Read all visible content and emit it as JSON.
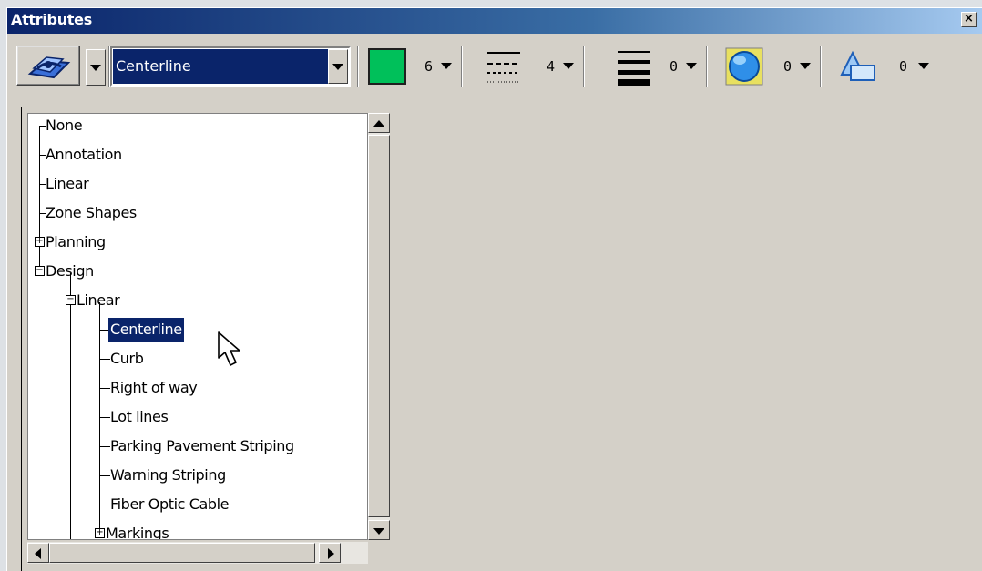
{
  "window": {
    "title": "Attributes",
    "close_label": "×"
  },
  "toolbar": {
    "level_combo_value": "Centerline",
    "color_value": "6",
    "style_value": "4",
    "weight_value": "0",
    "transparency_value": "0",
    "priority_value": "0",
    "colors": {
      "element_color": "#00c05a",
      "selection": "#0a246a"
    }
  },
  "tree": {
    "nodes": [
      {
        "label": "None"
      },
      {
        "label": "Annotation"
      },
      {
        "label": "Linear"
      },
      {
        "label": "Zone Shapes"
      },
      {
        "label": "Planning",
        "expander": "+"
      },
      {
        "label": "Design",
        "expander": "−"
      },
      {
        "label": "Linear",
        "expander": "−"
      },
      {
        "label": "Centerline",
        "selected": true
      },
      {
        "label": "Curb"
      },
      {
        "label": "Right of way"
      },
      {
        "label": "Lot lines"
      },
      {
        "label": "Parking Pavement Striping"
      },
      {
        "label": "Warning Striping"
      },
      {
        "label": "Fiber Optic Cable"
      },
      {
        "label": "Markings",
        "expander": "+"
      }
    ]
  }
}
